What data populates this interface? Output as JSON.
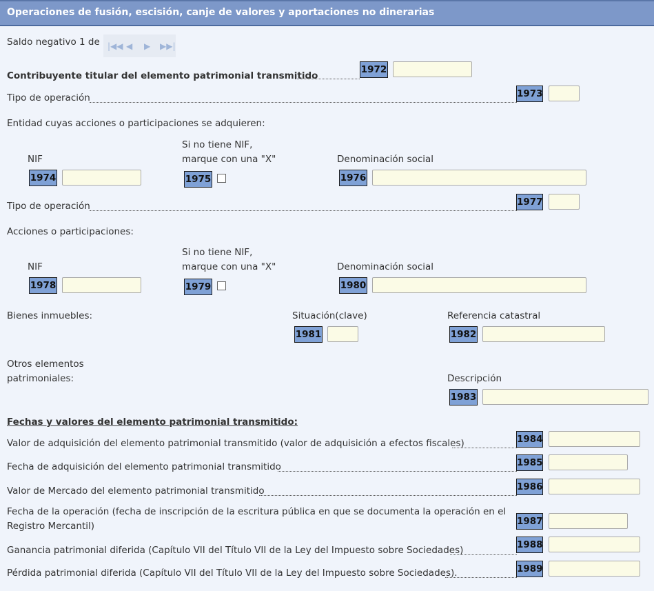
{
  "header": {
    "title": "Operaciones de fusión, escisión, canje de valores y aportaciones no dinerarias"
  },
  "pager": {
    "label": "Saldo negativo 1 de 1"
  },
  "section1": {
    "contribuyente": "Contribuyente titular del elemento patrimonial transmitido",
    "code": "1972"
  },
  "tipo1": {
    "label": "Tipo de operación",
    "code": "1973"
  },
  "entidad": {
    "title": "Entidad cuyas acciones o participaciones se adquieren:",
    "nif_label": "NIF",
    "nif_code": "1974",
    "sinif_label1": "Si no tiene NIF,",
    "sinif_label2": "marque con una \"X\"",
    "sinif_code": "1975",
    "denom_label": "Denominación social",
    "denom_code": "1976"
  },
  "tipo2": {
    "label": "Tipo de operación",
    "code": "1977"
  },
  "acciones": {
    "title": "Acciones o participaciones:",
    "nif_label": "NIF",
    "nif_code": "1978",
    "sinif_label1": "Si no tiene NIF,",
    "sinif_label2": "marque con una \"X\"",
    "sinif_code": "1979",
    "denom_label": "Denominación social",
    "denom_code": "1980"
  },
  "bienes": {
    "title": "Bienes inmuebles:",
    "situacion_label": "Situación(clave)",
    "situacion_code": "1981",
    "ref_label": "Referencia catastral",
    "ref_code": "1982"
  },
  "otros": {
    "title1": "Otros elementos",
    "title2": "patrimoniales:",
    "desc_label": "Descripción",
    "desc_code": "1983"
  },
  "fechas": {
    "title": "Fechas y valores del elemento patrimonial transmitido:",
    "rows": [
      {
        "label": "Valor de adquisición del elemento patrimonial transmitido (valor de adquisición a efectos fiscales)",
        "code": "1984"
      },
      {
        "label": "Fecha de adquisición del elemento patrimonial transmitido",
        "code": "1985"
      },
      {
        "label": "Valor de Mercado del elemento patrimonial transmitido",
        "code": "1986"
      },
      {
        "label1": "Fecha de la operación (fecha de inscripción de la escritura pública en que se documenta la operación en el",
        "label2": "Registro Mercantil)",
        "code": "1987"
      },
      {
        "label": "Ganancia patrimonial diferida (Capítulo VII del Título VII de la Ley del Impuesto sobre Sociedades)",
        "code": "1988"
      },
      {
        "label": "Pérdida patrimonial diferida (Capítulo VII del Título VII de la Ley del Impuesto sobre Sociedades).",
        "code": "1989"
      }
    ]
  }
}
